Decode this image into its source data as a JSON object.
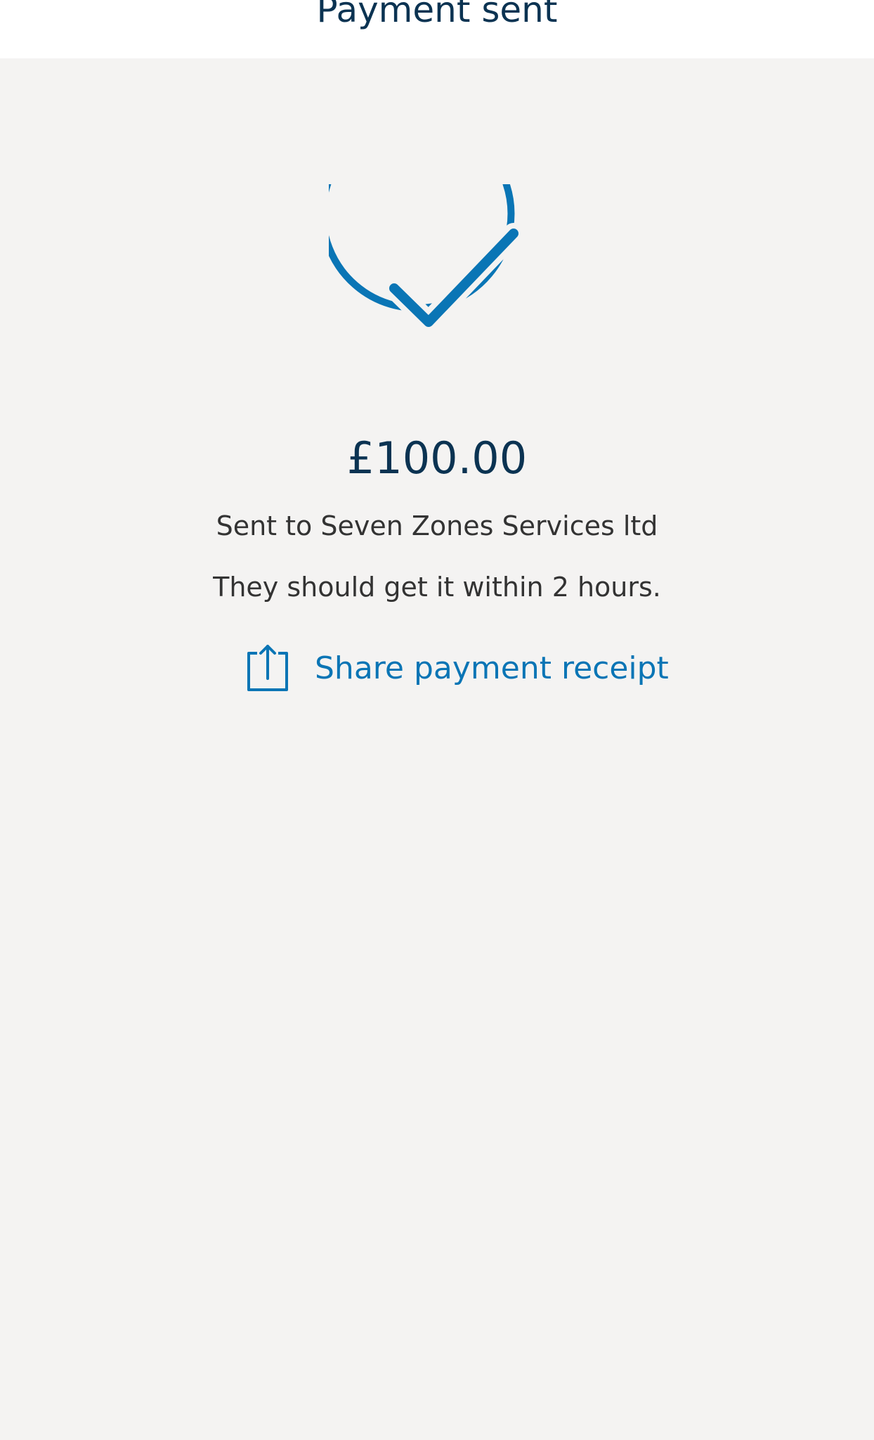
{
  "header": {
    "title": "Payment sent"
  },
  "status": {
    "icon": "check-circle-icon",
    "color": "#0a75b5"
  },
  "payment": {
    "amount": "£100.00",
    "recipient_text": "Sent to Seven Zones Services ltd",
    "timing_text": "They should get it within 2 hours."
  },
  "share": {
    "icon": "share-icon",
    "label": "Share payment receipt"
  },
  "colors": {
    "header_text": "#0b3352",
    "body_text": "#333333",
    "accent": "#0a75b5",
    "background": "#f4f3f2",
    "header_background": "#ffffff"
  }
}
